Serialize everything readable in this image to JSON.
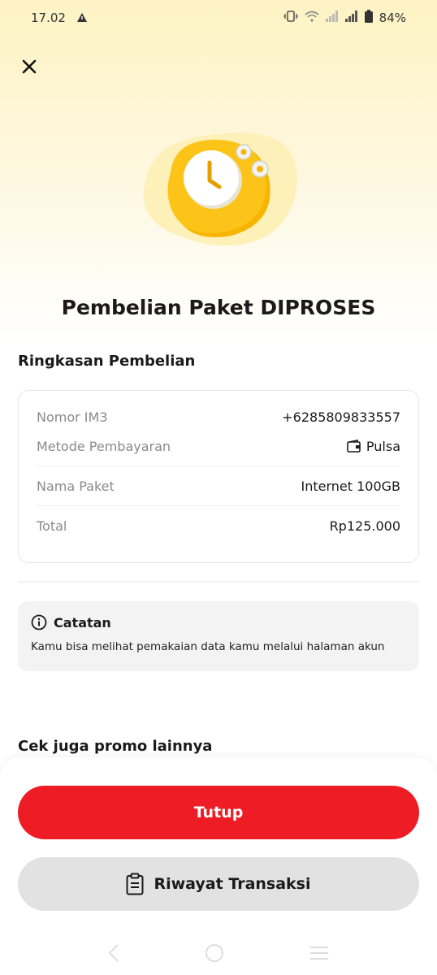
{
  "status_bar": {
    "time": "17.02",
    "battery": "84%"
  },
  "title": "Pembelian Paket DIPROSES",
  "summary": {
    "heading": "Ringkasan Pembelian",
    "rows": [
      {
        "label": "Nomor IM3",
        "value": "+6285809833557"
      },
      {
        "label": "Metode Pembayaran",
        "value": "Pulsa"
      },
      {
        "label": "Nama Paket",
        "value": "Internet 100GB"
      },
      {
        "label": "Total",
        "value": "Rp125.000"
      }
    ]
  },
  "note": {
    "heading": "Catatan",
    "text": "Kamu bisa melihat pemakaian data kamu melalui halaman akun"
  },
  "promo_heading": "Cek juga promo lainnya",
  "buttons": {
    "close_label": "Tutup",
    "history_label": "Riwayat Transaksi"
  },
  "colors": {
    "accent": "#ee1c25",
    "brand_yellow": "#fcc419"
  }
}
